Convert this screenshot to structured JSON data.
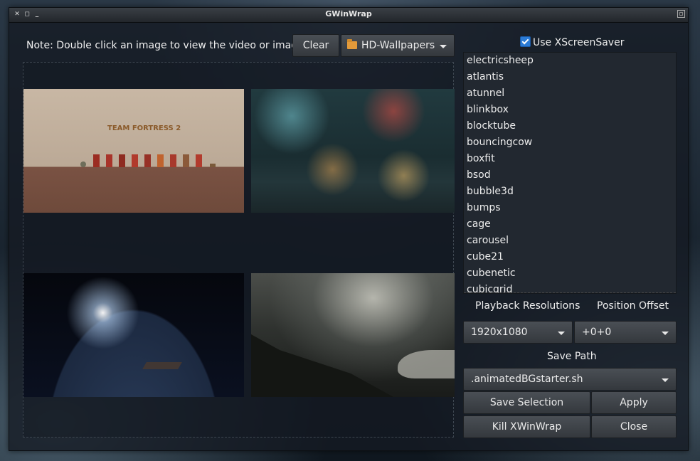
{
  "window": {
    "title": "GWinWrap"
  },
  "note": "Note: Double click an image to view the video or image.",
  "toolbar": {
    "clear_label": "Clear",
    "folder_label": "HD-Wallpapers"
  },
  "thumbnails": [
    {
      "caption": "TEAM FORTRESS 2"
    },
    {
      "caption": ""
    },
    {
      "caption": ""
    },
    {
      "caption": ""
    }
  ],
  "screensaver": {
    "use_label": "Use XScreenSaver",
    "checked": true,
    "items": [
      "electricsheep",
      "atlantis",
      "atunnel",
      "blinkbox",
      "blocktube",
      "bouncingcow",
      "boxfit",
      "bsod",
      "bubble3d",
      "bumps",
      "cage",
      "carousel",
      "cube21",
      "cubenetic",
      "cubicgrid"
    ]
  },
  "settings": {
    "playback_label": "Playback Resolutions",
    "offset_label": "Position Offset",
    "resolution_value": "1920x1080",
    "offset_value": "+0+0",
    "save_path_label": "Save Path",
    "save_path_value": ".animatedBGstarter.sh"
  },
  "actions": {
    "save_selection": "Save Selection",
    "apply": "Apply",
    "kill": "Kill XWinWrap",
    "close": "Close"
  }
}
